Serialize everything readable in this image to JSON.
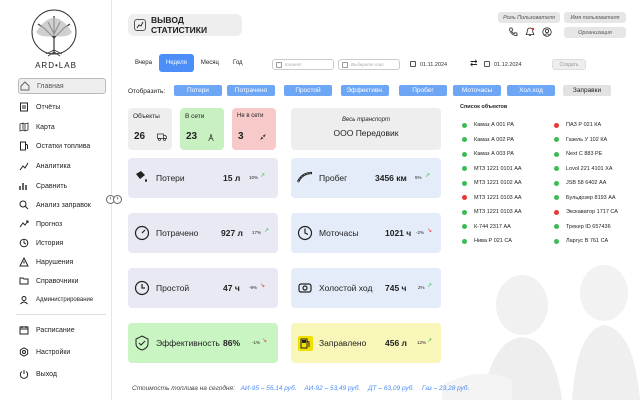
{
  "brand": {
    "name": "ARD•LAB"
  },
  "sidebar": {
    "items": [
      {
        "label": "Главная",
        "icon": "home-icon"
      },
      {
        "label": "Отчёты",
        "icon": "reports-icon"
      },
      {
        "label": "Карта",
        "icon": "map-icon"
      },
      {
        "label": "Остатки топлива",
        "icon": "fuel-icon"
      },
      {
        "label": "Аналитика",
        "icon": "analytics-icon"
      },
      {
        "label": "Сравнить",
        "icon": "compare-icon"
      },
      {
        "label": "Анализ заправок",
        "icon": "refuel-icon"
      },
      {
        "label": "Прогноз",
        "icon": "forecast-icon"
      },
      {
        "label": "История",
        "icon": "history-icon"
      },
      {
        "label": "Нарушения",
        "icon": "violations-icon"
      },
      {
        "label": "Справочники",
        "icon": "directory-icon"
      },
      {
        "label": "Администрирование",
        "icon": "admin-icon"
      }
    ],
    "bottom": [
      {
        "label": "Расписание",
        "icon": "schedule-icon"
      },
      {
        "label": "Настройки",
        "icon": "settings-icon"
      },
      {
        "label": "Выход",
        "icon": "logout-icon"
      }
    ]
  },
  "header": {
    "title": "ВЫВОД СТАТИСТИКИ",
    "user_role": "Роль Пользователя",
    "user_name": "Имя пользователя",
    "organization": "Организация"
  },
  "period": {
    "tabs": [
      "Вчера",
      "Неделя",
      "Месяц",
      "Год"
    ],
    "active_tab": "Неделя",
    "client_placeholder": "Клиент",
    "type_placeholder": "Выберите тип",
    "date_from": "01.11.2024",
    "date_to": "01.12.2024",
    "show_label": "Создать"
  },
  "filters": {
    "label": "Отобразить:",
    "chips": [
      "Потери",
      "Потрачено",
      "Простой",
      "Эффективн.",
      "Пробег",
      "Моточасы",
      "Хол.ход",
      "Заправки"
    ]
  },
  "summary": {
    "objects": {
      "label": "Объекты",
      "value": "26"
    },
    "online": {
      "label": "В сети",
      "value": "23"
    },
    "offline": {
      "label": "Не в сети",
      "value": "3"
    },
    "transport": {
      "label": "Весь транспорт",
      "value": "ООО Передовик"
    }
  },
  "metrics": [
    {
      "label": "Потери",
      "value": "15 л",
      "pct": "10%",
      "trend": "up",
      "icon": "fuel-loss-icon"
    },
    {
      "label": "Пробег",
      "value": "3456 км",
      "pct": "5%",
      "trend": "up",
      "icon": "road-icon"
    },
    {
      "label": "Потрачено",
      "value": "927 л",
      "pct": "17%",
      "trend": "up",
      "icon": "gauge-icon"
    },
    {
      "label": "Моточасы",
      "value": "1021 ч",
      "pct": "-2%",
      "trend": "down",
      "icon": "engine-hours-icon"
    },
    {
      "label": "Простой",
      "value": "47 ч",
      "pct": "-9%",
      "trend": "down",
      "icon": "idle-icon"
    },
    {
      "label": "Холостой ход",
      "value": "745 ч",
      "pct": "2%",
      "trend": "up",
      "icon": "engine-idle-icon"
    },
    {
      "label": "Эффективность",
      "value": "86%",
      "pct": "-1%",
      "trend": "down",
      "icon": "efficiency-icon"
    },
    {
      "label": "Заправлено",
      "value": "456 л",
      "pct": "12%",
      "trend": "up",
      "icon": "fuel-pump-icon"
    }
  ],
  "objects_list": {
    "title": "Список объектов",
    "items": [
      {
        "name": "Камаз А 001 РА",
        "status": "#3cba54"
      },
      {
        "name": "Камаз А 002 РА",
        "status": "#3cba54"
      },
      {
        "name": "Камаз А 003 РА",
        "status": "#3cba54"
      },
      {
        "name": "МТЗ 1221 0101 АА",
        "status": "#3cba54"
      },
      {
        "name": "МТЗ 1221 0102 АА",
        "status": "#3cba54"
      },
      {
        "name": "МТЗ 1221 0103 АА",
        "status": "#e53935"
      },
      {
        "name": "МТЗ 1221 0103 АА",
        "status": "#3cba54"
      },
      {
        "name": "К-744 2317 АА",
        "status": "#3cba54"
      },
      {
        "name": "Нива Р 021 СА",
        "status": "#3cba54"
      },
      {
        "name": "ПАЗ Р 021 КА",
        "status": "#e53935"
      },
      {
        "name": "Газель У 102 КА",
        "status": "#3cba54"
      },
      {
        "name": "Next С 883 РЕ",
        "status": "#3cba54"
      },
      {
        "name": "Lovol 221 4101 ХА",
        "status": "#3cba54"
      },
      {
        "name": "JSB 58 6402 АА",
        "status": "#3cba54"
      },
      {
        "name": "Бульдозер 8193 АА",
        "status": "#3cba54"
      },
      {
        "name": "Экскаватор 1717 СА",
        "status": "#e53935"
      },
      {
        "name": "Трекер ID 657436",
        "status": "#3cba54"
      },
      {
        "name": "Ларгус В 761 СА",
        "status": "#3cba54"
      }
    ]
  },
  "footer": {
    "label": "Стоимость топлива на сегодня:",
    "prices": [
      "АИ-95 – 55,14 руб.",
      "АИ-92 – 53,49 руб.",
      "ДТ – 63,09 руб.",
      "Газ – 23,28 руб."
    ]
  },
  "colors": {
    "accent": "#4c8ef7",
    "online_bg": "#c8f0c0",
    "offline_bg": "#f8c9c9",
    "metric_bg": "#e8e9f3",
    "metric_blue_bg": "#e3ecf8",
    "eff_bg": "#c9f5c2",
    "refuel_bg": "#f8f6b8"
  }
}
